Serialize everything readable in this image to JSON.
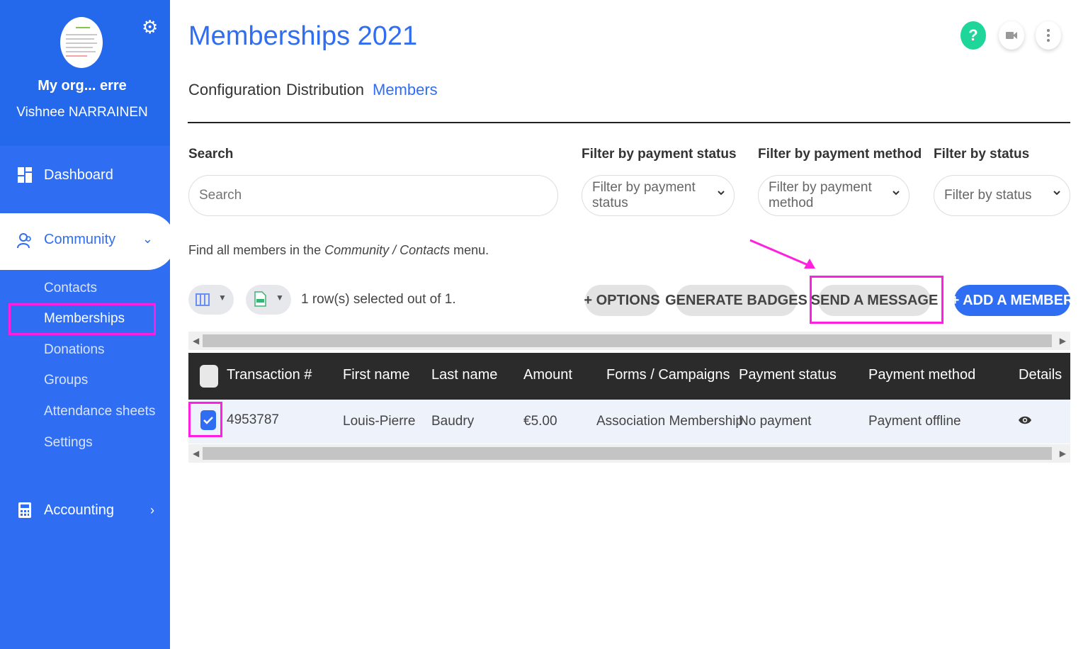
{
  "sidebar": {
    "org_name": "My org... erre",
    "user_name": "Vishnee NARRAINEN",
    "dashboard_label": "Dashboard",
    "community_label": "Community",
    "sub_items": [
      "Contacts",
      "Memberships",
      "Donations",
      "Groups",
      "Attendance sheets",
      "Settings"
    ],
    "active_sub_item": "Memberships",
    "accounting_label": "Accounting"
  },
  "header": {
    "title": "Memberships 2021",
    "help_label": "?"
  },
  "tabs": [
    "Configuration",
    "Distribution",
    "Members"
  ],
  "active_tab": "Members",
  "filters": {
    "search_label": "Search",
    "search_placeholder": "Search",
    "payment_status_label": "Filter by payment status",
    "payment_status_value": "Filter by payment status",
    "payment_method_label": "Filter by payment method",
    "payment_method_value": "Filter by payment method",
    "status_label": "Filter by status",
    "status_value": "Filter by status"
  },
  "info": {
    "prefix": "Find all members in the ",
    "path": "Community / Contacts",
    "suffix": " menu."
  },
  "toolbar": {
    "selection_text": "1 row(s) selected out of 1.",
    "options_label": "+ OPTIONS",
    "badges_label": "GENERATE BADGES",
    "message_label": "SEND A MESSAGE",
    "add_member_label": "+ ADD A MEMBER"
  },
  "table": {
    "columns": [
      "Transaction #",
      "First name",
      "Last name",
      "Amount",
      "Forms / Campaigns",
      "Payment status",
      "Payment method",
      "Details"
    ],
    "rows": [
      [
        "4953787",
        "Louis-Pierre",
        "Baudry",
        "€5.00",
        "Association Membership",
        "No payment",
        "Payment offline"
      ]
    ]
  },
  "colors": {
    "brand_blue": "#2f6ef2",
    "highlight": "#ff1fe0",
    "help_green": "#1fd69a"
  },
  "icons": [
    "settings-gear-icon",
    "dashboard-icon",
    "community-icon",
    "accounting-icon",
    "help-icon",
    "video-icon",
    "more-vertical-icon",
    "columns-icon",
    "csv-export-icon",
    "eye-icon"
  ]
}
